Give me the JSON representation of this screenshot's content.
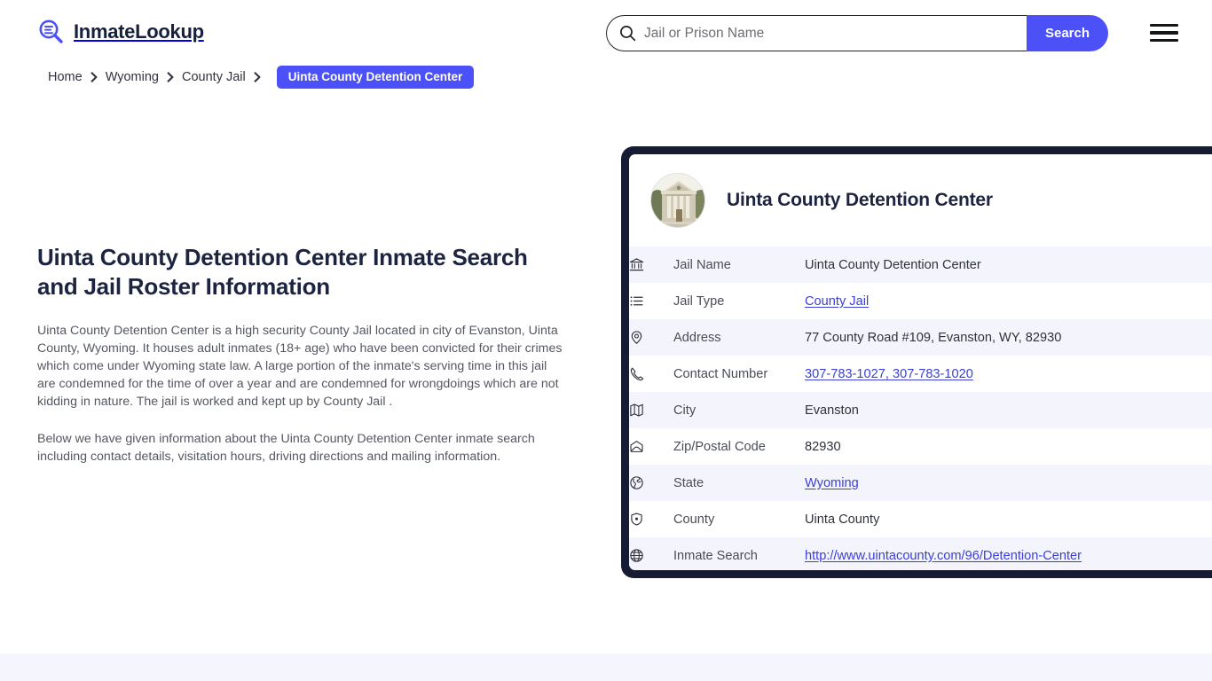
{
  "header": {
    "logo": {
      "icon": "search-list-logo-icon",
      "text": "InmateLookup"
    },
    "search": {
      "placeholder": "Jail or Prison Name",
      "value": "",
      "icon": "search-icon",
      "button_label": "Search"
    },
    "menu_icon": "hamburger-menu-icon",
    "accent_color": "#4b51f7"
  },
  "breadcrumb": {
    "items": [
      {
        "label": "Home",
        "current": false
      },
      {
        "label": "Wyoming",
        "current": false
      },
      {
        "label": "County Jail",
        "current": false
      }
    ],
    "current": "Uinta County Detention Center",
    "separator_icon": "chevron-right-icon"
  },
  "main": {
    "title": "Uinta County Detention Center Inmate Search and Jail Roster Information",
    "paragraph_1": "Uinta County Detention Center is a high security County Jail located in city of Evanston, Uinta County, Wyoming. It houses adult inmates (18+ age) who have been convicted for their crimes which come under Wyoming state law. A large portion of the inmate's serving time in this jail are condemned for the time of over a year and are condemned for wrongdoings which are not kidding in nature. The jail is worked and kept up by County Jail .",
    "paragraph_2": "Below we have given information about the Uinta County Detention Center inmate search including contact details, visitation hours, driving directions and mailing information."
  },
  "card": {
    "photo_alt": "uinta-county-courthouse-photo",
    "title": "Uinta County Detention Center",
    "rows": [
      {
        "icon": "bank-icon",
        "label": "Jail Name",
        "value": "Uinta County Detention Center",
        "link": false
      },
      {
        "icon": "list-icon",
        "label": "Jail Type",
        "value": "County Jail",
        "link": true
      },
      {
        "icon": "map-pin-icon",
        "label": "Address",
        "value": "77 County Road #109, Evanston, WY, 82930",
        "link": false
      },
      {
        "icon": "phone-icon",
        "label": "Contact Number",
        "value": "307-783-1027, 307-783-1020",
        "link": true
      },
      {
        "icon": "map-icon",
        "label": "City",
        "value": "Evanston",
        "link": false
      },
      {
        "icon": "envelope-icon",
        "label": "Zip/Postal Code",
        "value": "82930",
        "link": false
      },
      {
        "icon": "globe-icon",
        "label": "State",
        "value": "Wyoming",
        "link": true
      },
      {
        "icon": "shield-icon",
        "label": "County",
        "value": "Uinta County",
        "link": false
      },
      {
        "icon": "globe-grid-icon",
        "label": "Inmate Search",
        "value": "http://www.uintacounty.com/96/Detention-Center",
        "link": true
      }
    ]
  }
}
